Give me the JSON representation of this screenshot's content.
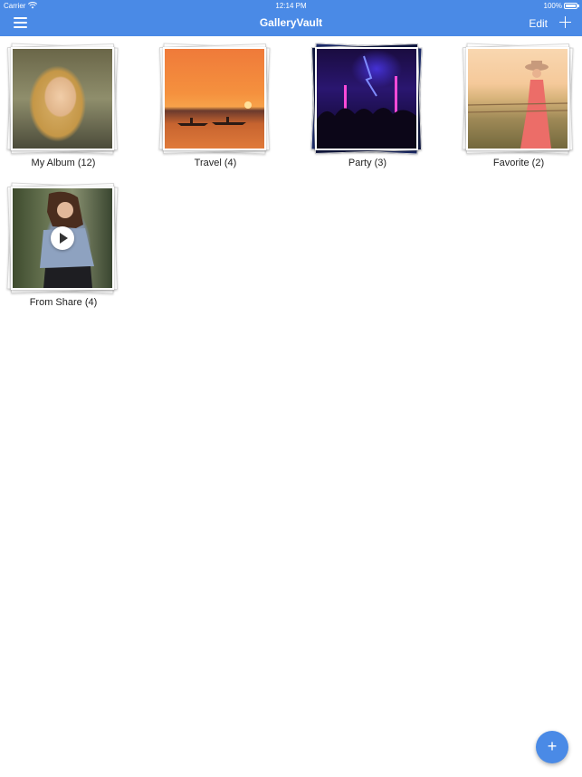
{
  "status_bar": {
    "carrier": "Carrier",
    "time": "12:14 PM",
    "battery": "100%"
  },
  "nav": {
    "title": "GalleryVault",
    "edit_label": "Edit",
    "menu_icon": "hamburger-menu-icon",
    "add_icon": "plus-icon"
  },
  "albums": [
    {
      "label": "My Album (12)"
    },
    {
      "label": "Travel (4)"
    },
    {
      "label": "Party (3)"
    },
    {
      "label": "Favorite (2)"
    },
    {
      "label": "From Share (4)"
    }
  ],
  "fab": {
    "label": "+"
  },
  "colors": {
    "accent": "#4a8ae6",
    "background": "#ffffff"
  }
}
